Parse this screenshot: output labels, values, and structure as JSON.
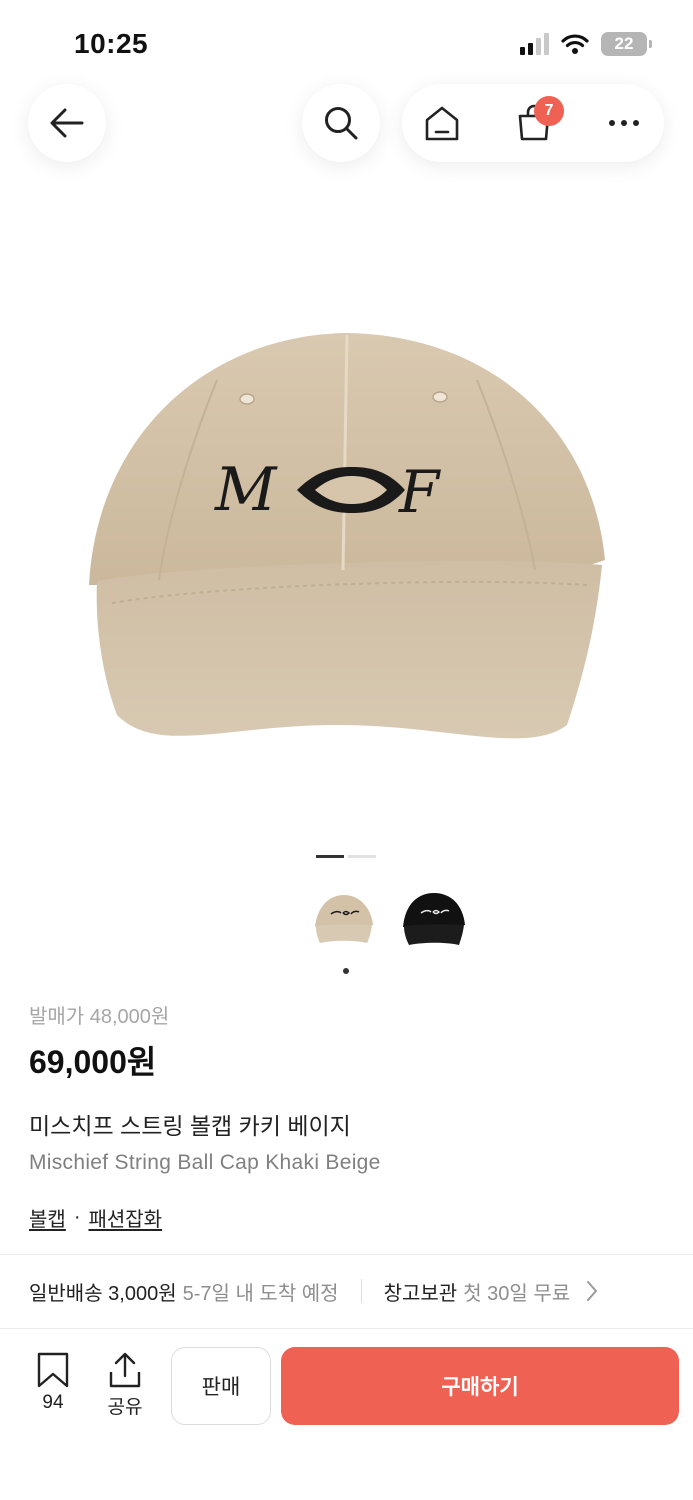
{
  "status_bar": {
    "time": "10:25",
    "battery": "22"
  },
  "nav": {
    "cart_count": "7"
  },
  "product": {
    "release_price": "발매가 48,000원",
    "price": "69,000원",
    "name_ko": "미스치프 스트링 볼캡 카키 베이지",
    "name_en": "Mischief String Ball Cap Khaki Beige",
    "categories": [
      "볼캡",
      "패션잡화"
    ],
    "category_separator": "·",
    "logo_text": "M◇F"
  },
  "gallery": {
    "images": 2,
    "current": 1,
    "thumbnails": [
      "khaki-beige",
      "black"
    ]
  },
  "shipping": {
    "label": "일반배송 3,000원",
    "eta": "5-7일 내 도착 예정",
    "storage_label": "창고보관",
    "storage_sub": "첫 30일 무료"
  },
  "bottom_bar": {
    "bookmark_count": "94",
    "share_label": "공유",
    "sell_label": "판매",
    "buy_label": "구매하기"
  },
  "colors": {
    "accent": "#ef6253",
    "cap_khaki": "#d3c2a8",
    "text_muted": "#8e8e8e"
  }
}
